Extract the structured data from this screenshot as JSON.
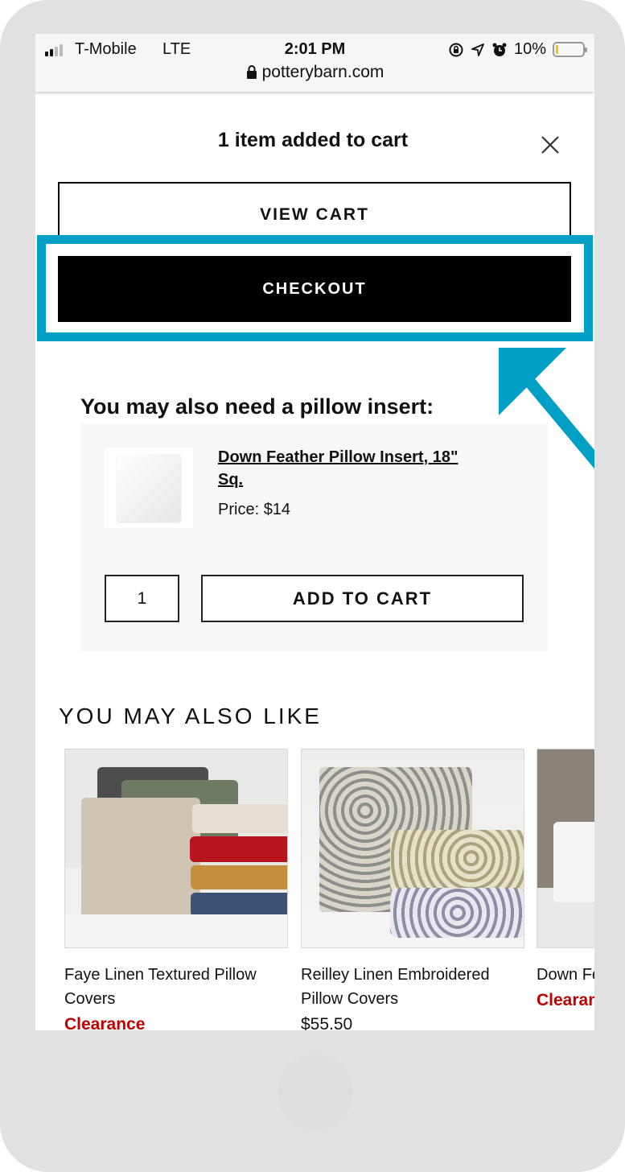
{
  "status_bar": {
    "carrier": "T-Mobile",
    "network": "LTE",
    "time": "2:01 PM",
    "battery_percent_label": "10%",
    "battery_level": 0.1,
    "signal_bars_active": 2,
    "signal_bars_total": 4,
    "icons": [
      "orientation-lock-icon",
      "location-arrow-icon",
      "alarm-icon"
    ]
  },
  "browser": {
    "url": "potterybarn.com",
    "secure_icon": "lock-icon"
  },
  "modal": {
    "title": "1 item added to cart",
    "close_icon": "close-icon",
    "view_cart_label": "VIEW CART",
    "checkout_label": "CHECKOUT",
    "highlight_color": "#00a0c6"
  },
  "upsell": {
    "heading": "You may also need a pillow insert:",
    "product_name": "Down Feather Pillow Insert, 18\" Sq.",
    "price_label": "Price:",
    "price": "$14",
    "quantity": "1",
    "add_to_cart_label": "ADD TO CART"
  },
  "also_like": {
    "heading": "YOU MAY ALSO LIKE",
    "products": [
      {
        "name": "Faye Linen Textured Pillow Covers",
        "price": "Clearance",
        "price_style": "clearance"
      },
      {
        "name": "Reilley Linen Embroidered Pillow Covers",
        "price": "$55.50",
        "price_style": "regular"
      },
      {
        "name": "Down Feather Pillow Insert",
        "name_visible": "Dow Inse",
        "price": "Clearance",
        "price_style": "clearance"
      }
    ]
  },
  "colors": {
    "accent": "#00a0c6",
    "clearance": "#c00000",
    "button_dark": "#000000",
    "card_bg": "#f7f7f7",
    "frame": "#e1e1e1"
  }
}
